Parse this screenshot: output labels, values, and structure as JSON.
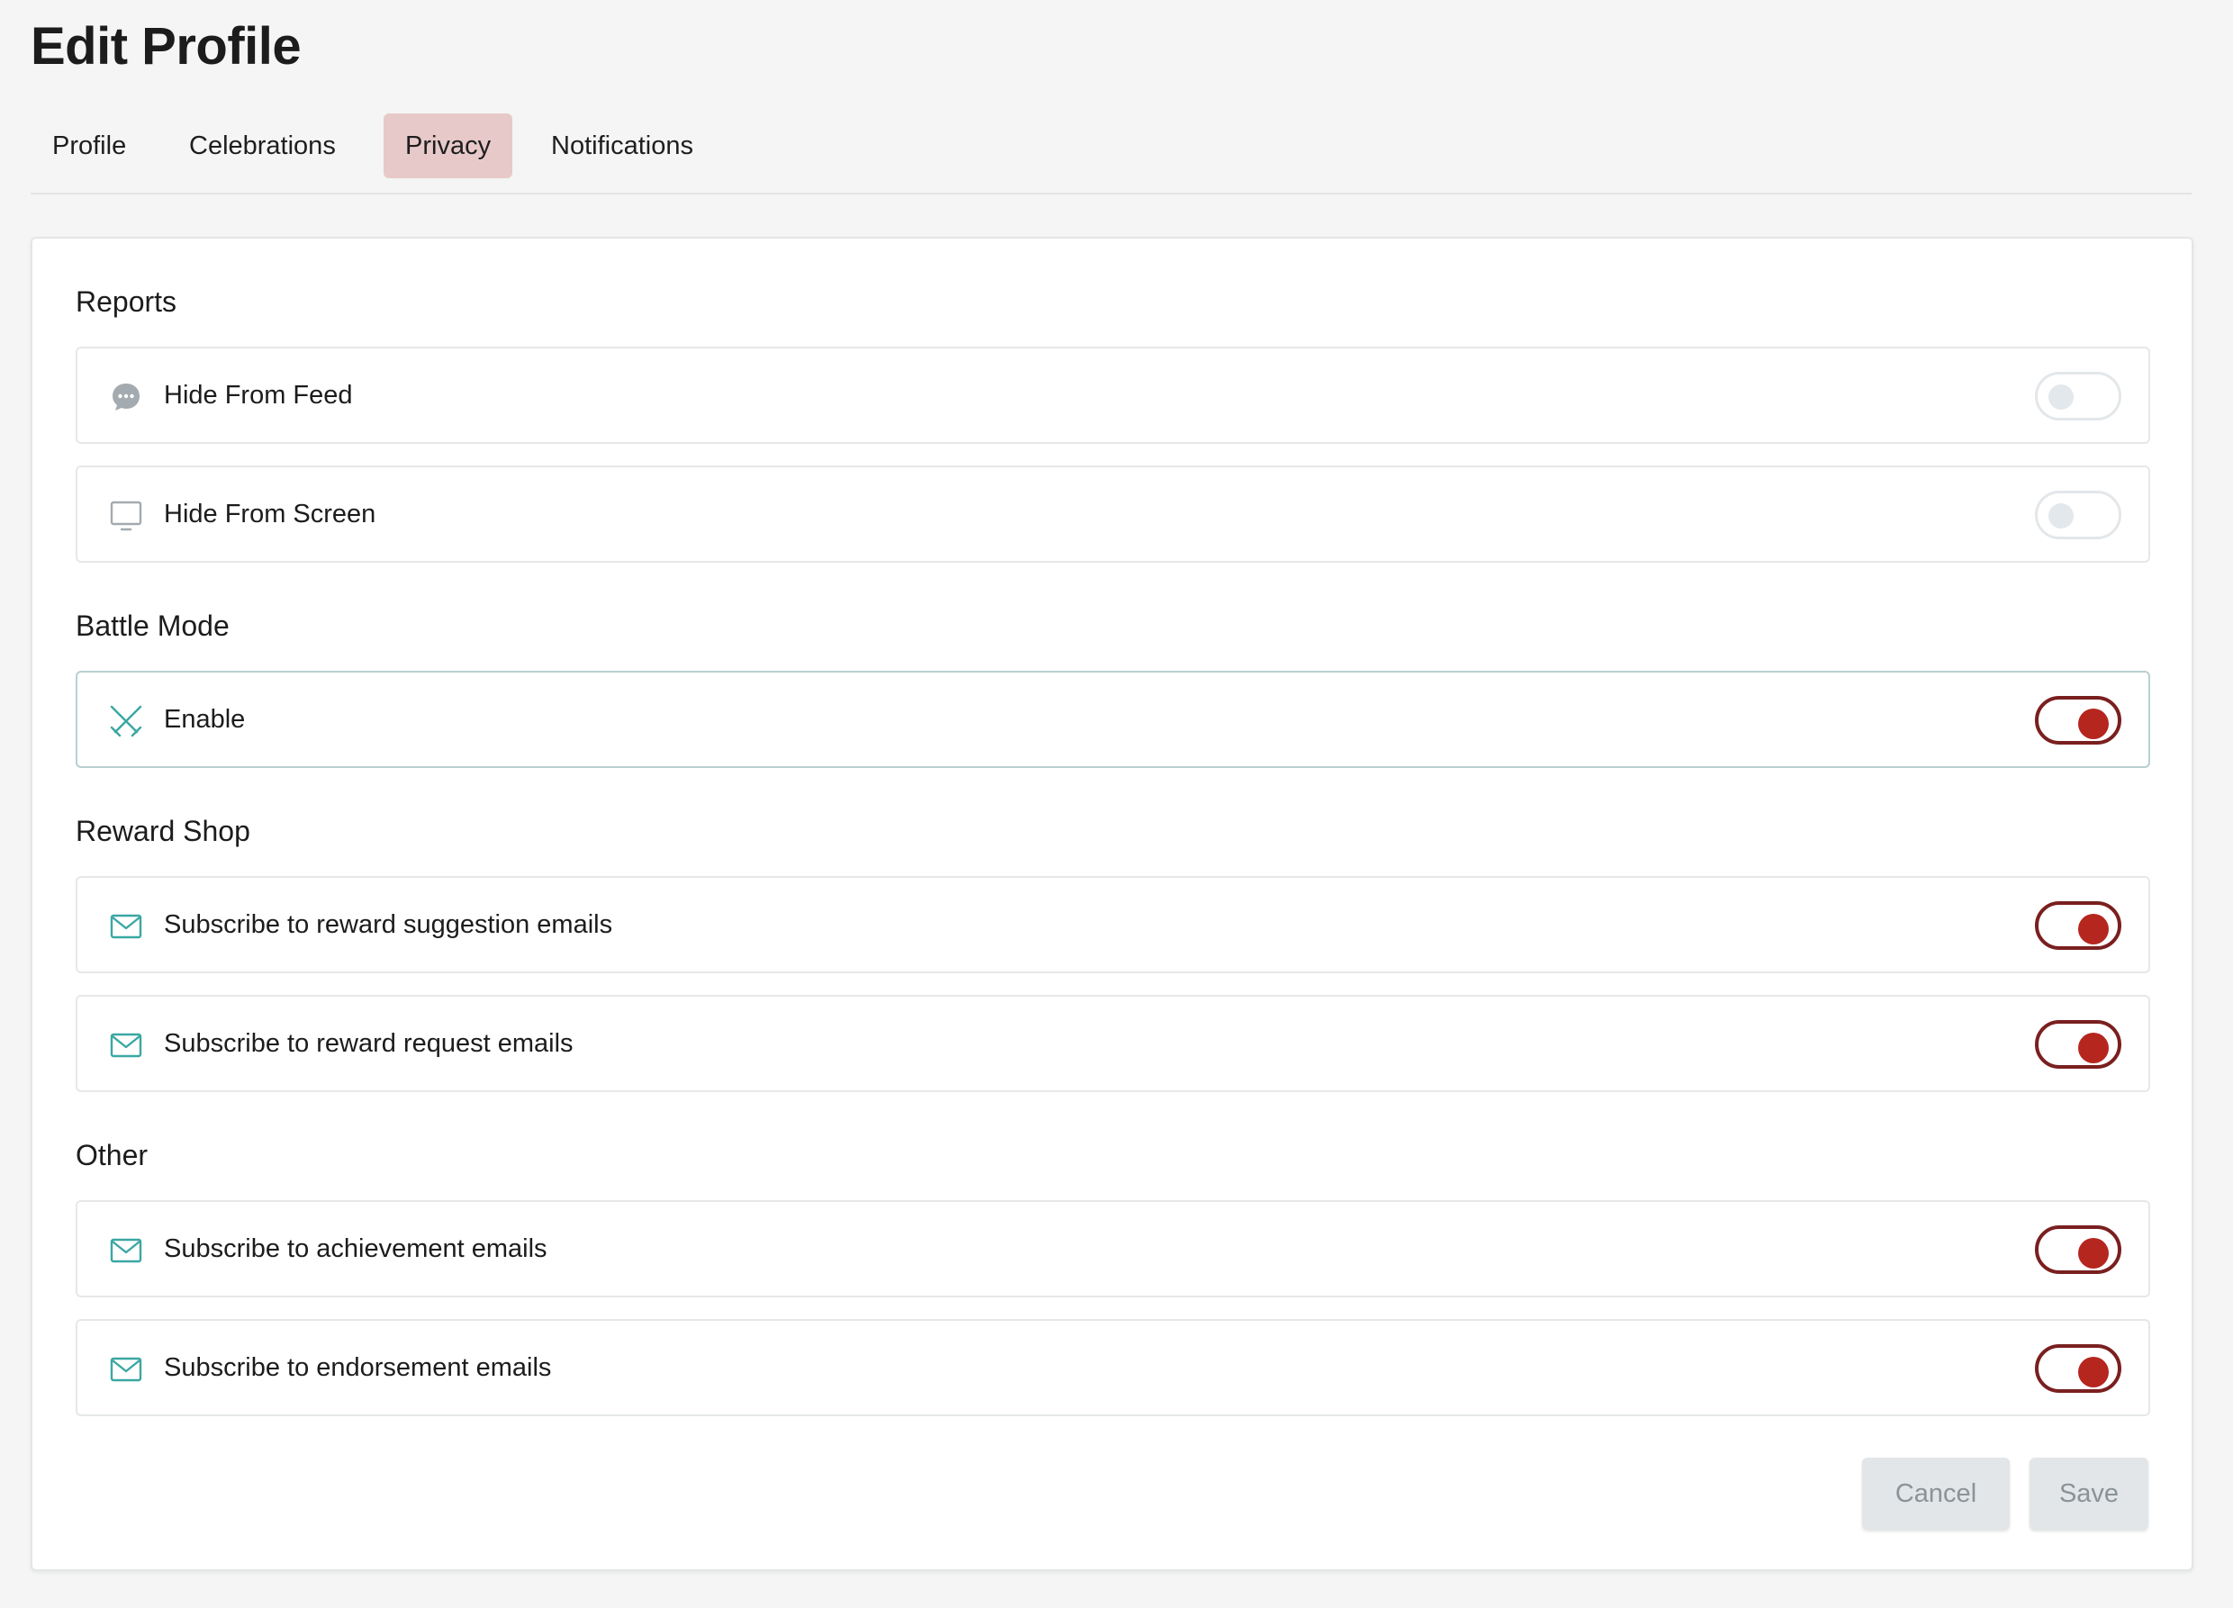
{
  "page": {
    "title": "Edit Profile"
  },
  "tabs": [
    {
      "label": "Profile",
      "active": false
    },
    {
      "label": "Celebrations",
      "active": false
    },
    {
      "label": "Privacy",
      "active": true
    },
    {
      "label": "Notifications",
      "active": false
    }
  ],
  "sections": [
    {
      "title": "Reports",
      "items": [
        {
          "label": "Hide From Feed",
          "icon": "chat-bubble-icon",
          "enabled": false
        },
        {
          "label": "Hide From Screen",
          "icon": "monitor-icon",
          "enabled": false
        }
      ]
    },
    {
      "title": "Battle Mode",
      "items": [
        {
          "label": "Enable",
          "icon": "crossed-swords-icon",
          "enabled": true
        }
      ]
    },
    {
      "title": "Reward Shop",
      "items": [
        {
          "label": "Subscribe to reward suggestion emails",
          "icon": "envelope-icon",
          "enabled": true
        },
        {
          "label": "Subscribe to reward request emails",
          "icon": "envelope-icon",
          "enabled": true
        }
      ]
    },
    {
      "title": "Other",
      "items": [
        {
          "label": "Subscribe to achievement emails",
          "icon": "envelope-icon",
          "enabled": true
        },
        {
          "label": "Subscribe to endorsement emails",
          "icon": "envelope-icon",
          "enabled": true
        }
      ]
    }
  ],
  "actions": {
    "cancel_label": "Cancel",
    "save_label": "Save"
  },
  "colors": {
    "active_tab_bg": "#e8c9c9",
    "toggle_on": "#b5261f",
    "toggle_on_border": "#7a1f1f",
    "icon_teal": "#3aa7a3",
    "icon_grey": "#9aa3a8"
  }
}
